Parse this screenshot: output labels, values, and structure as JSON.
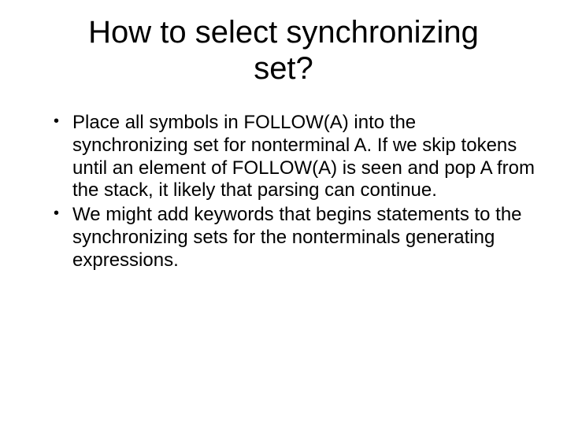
{
  "title": "How to select synchronizing set?",
  "bullets": [
    "Place all symbols in FOLLOW(A) into the synchronizing set for nonterminal A. If we skip tokens until an element of FOLLOW(A) is seen and pop A from the stack, it likely that parsing can continue.",
    "We might add keywords that begins statements to the synchronizing sets for the nonterminals generating expressions."
  ]
}
